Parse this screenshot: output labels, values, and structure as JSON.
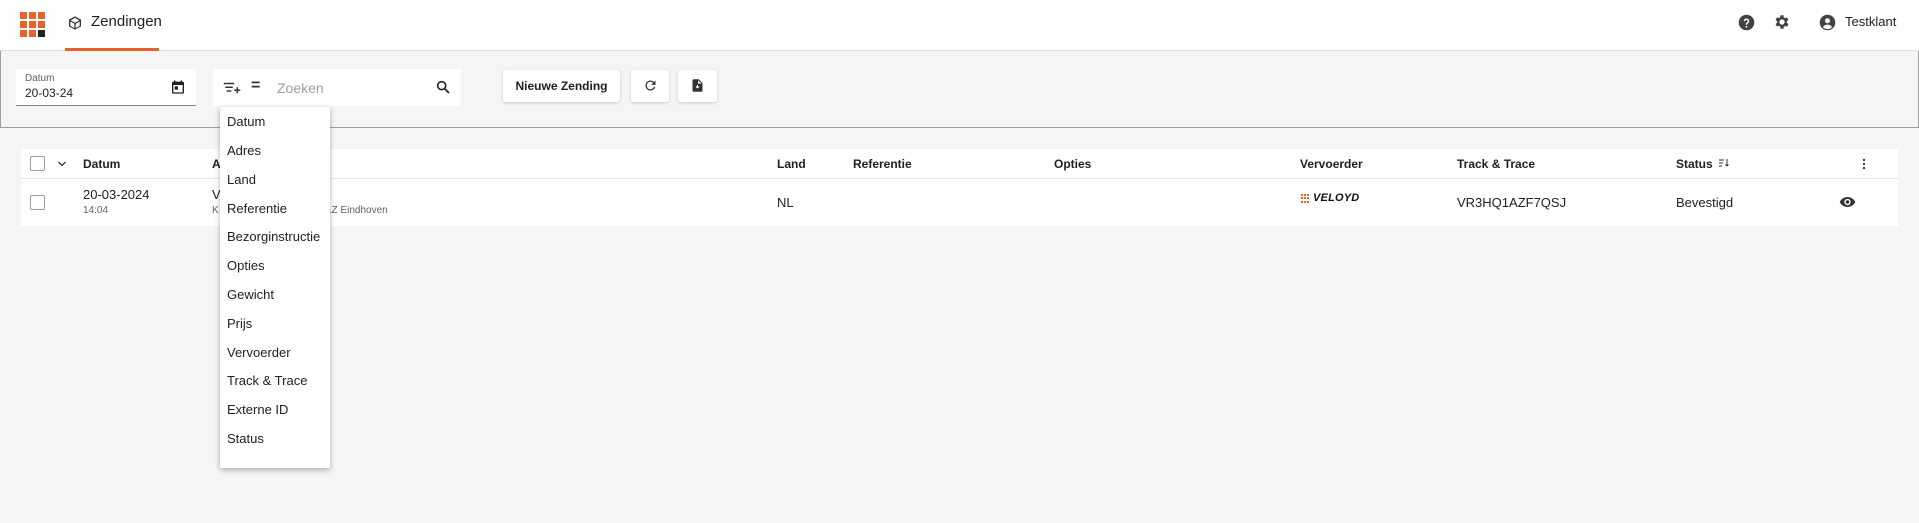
{
  "app": {
    "tab_label": "Zendingen",
    "user_name": "Testklant",
    "accent": "#e8632a"
  },
  "filters": {
    "date_label": "Datum",
    "date_value": "20-03-24",
    "search_placeholder": "Zoeken",
    "new_button": "Nieuwe Zending"
  },
  "table": {
    "headers": {
      "datum": "Datum",
      "adres": "A",
      "land": "Land",
      "referentie": "Referentie",
      "opties": "Opties",
      "vervoerder": "Vervoerder",
      "track": "Track & Trace",
      "status": "Status"
    },
    "rows": [
      {
        "date": "20-03-2024",
        "time": "14:04",
        "address_name": "V",
        "address_line_start": "K",
        "address_line_end": "LZ Eindhoven",
        "country": "NL",
        "carrier": "VELOYD",
        "tracking": "VR3HQ1AZF7QSJ",
        "status": "Bevestigd"
      }
    ]
  },
  "column_menu": {
    "items": [
      "Datum",
      "Adres",
      "Land",
      "Referentie",
      "Bezorginstructie",
      "Opties",
      "Gewicht",
      "Prijs",
      "Vervoerder",
      "Track & Trace",
      "Externe ID",
      "Status"
    ]
  },
  "icons": {
    "apps": "apps-grid-icon",
    "tab": "package-icon",
    "help": "help-icon",
    "settings": "gear-icon",
    "user": "account-circle-icon",
    "calendar": "calendar-icon",
    "filter_add": "filter-add-icon",
    "search": "search-icon",
    "refresh": "refresh-icon",
    "export": "file-export-icon",
    "view": "eye-icon"
  }
}
